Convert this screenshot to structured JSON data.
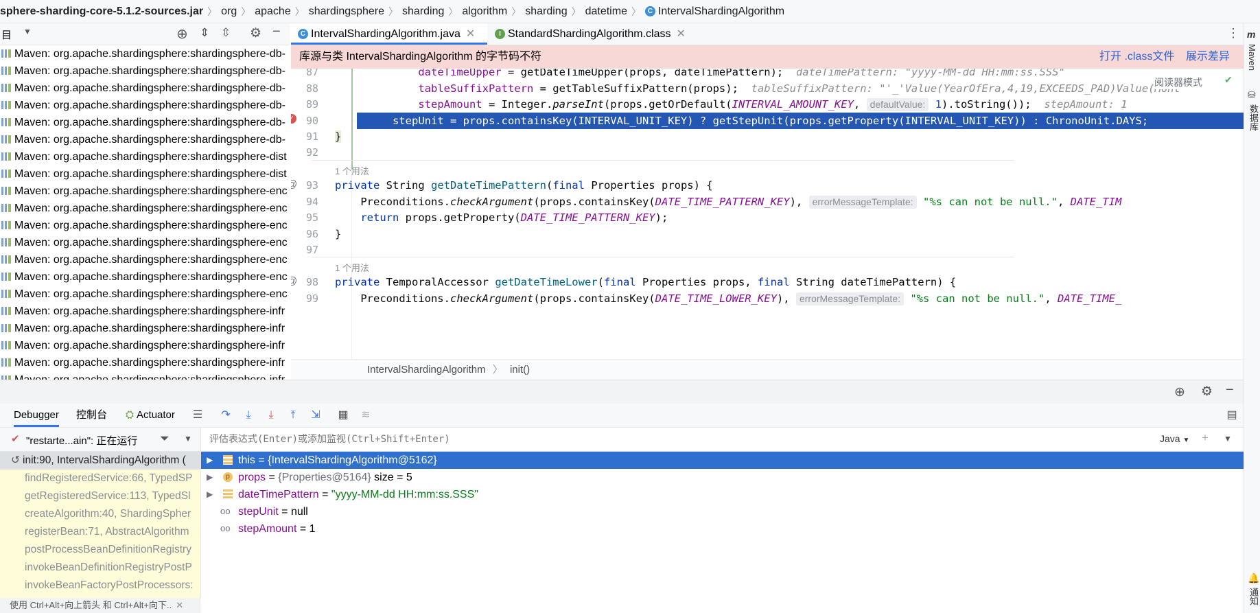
{
  "breadcrumb": [
    "sphere-sharding-core-5.1.2-sources.jar",
    "org",
    "apache",
    "shardingsphere",
    "sharding",
    "algorithm",
    "sharding",
    "datetime",
    "IntervalShardingAlgorithm"
  ],
  "project_panel": {
    "title": "目",
    "items": [
      "Maven: org.apache.shardingsphere:shardingsphere-db-",
      "Maven: org.apache.shardingsphere:shardingsphere-db-",
      "Maven: org.apache.shardingsphere:shardingsphere-db-",
      "Maven: org.apache.shardingsphere:shardingsphere-db-",
      "Maven: org.apache.shardingsphere:shardingsphere-db-",
      "Maven: org.apache.shardingsphere:shardingsphere-db-",
      "Maven: org.apache.shardingsphere:shardingsphere-dist",
      "Maven: org.apache.shardingsphere:shardingsphere-dist",
      "Maven: org.apache.shardingsphere:shardingsphere-enc",
      "Maven: org.apache.shardingsphere:shardingsphere-enc",
      "Maven: org.apache.shardingsphere:shardingsphere-enc",
      "Maven: org.apache.shardingsphere:shardingsphere-enc",
      "Maven: org.apache.shardingsphere:shardingsphere-enc",
      "Maven: org.apache.shardingsphere:shardingsphere-enc",
      "Maven: org.apache.shardingsphere:shardingsphere-enc",
      "Maven: org.apache.shardingsphere:shardingsphere-infr",
      "Maven: org.apache.shardingsphere:shardingsphere-infr",
      "Maven: org.apache.shardingsphere:shardingsphere-infr",
      "Maven: org.apache.shardingsphere:shardingsphere-infr",
      "Maven: org.apache.shardingsphere:shardingsphere-infr"
    ]
  },
  "tabs": [
    {
      "label": "IntervalShardingAlgorithm.java",
      "icon": "C"
    },
    {
      "label": "StandardShardingAlgorithm.class",
      "icon": "I"
    }
  ],
  "banner": {
    "message": "库源与类 IntervalShardingAlgorithm 的字节码不符",
    "open_class": "打开 .class文件",
    "show_diff": "展示差异"
  },
  "reader_mode": "阅读器模式",
  "code": {
    "l87": {
      "num": "87",
      "var": "dateTimeUpper",
      "rest": " = getDateTimeUpper(props, dateTimePattern);",
      "hint": "dateTimePattern: \"yyyy-MM-dd HH:mm:ss.SSS\""
    },
    "l88": {
      "num": "88",
      "var": "tableSuffixPattern",
      "rest": " = getTableSuffixPattern(props);",
      "hint": "tableSuffixPattern: \"'_'Value(YearOfEra,4,19,EXCEEDS_PAD)Value(Mont"
    },
    "l89": {
      "num": "89",
      "var": "stepAmount",
      "a": " = Integer.",
      "method": "parseInt",
      "b": "(props.getOrDefault(",
      "const": "INTERVAL_AMOUNT_KEY",
      "c": ", ",
      "param": "defaultValue:",
      "val": "1",
      "d": ").toString());",
      "hint": "stepAmount: 1"
    },
    "l90": {
      "num": "90",
      "text": "stepUnit = props.containsKey(INTERVAL_UNIT_KEY) ? getStepUnit(props.getProperty(INTERVAL_UNIT_KEY)) : ChronoUnit.DAYS;"
    },
    "l91": {
      "num": "91",
      "text": "}"
    },
    "l92": {
      "num": "92"
    },
    "usages1": "1 个用法",
    "l93": {
      "num": "93",
      "kw1": "private",
      "type": " String ",
      "method": "getDateTimePattern",
      "a": "(",
      "kw2": "final",
      "b": " Properties props) {"
    },
    "l94": {
      "num": "94",
      "a": "Preconditions.",
      "method": "checkArgument",
      "b": "(props.containsKey(",
      "const": "DATE_TIME_PATTERN_KEY",
      "c": "), ",
      "param": "errorMessageTemplate:",
      "str": " \"%s can not be null.\"",
      "d": ", ",
      "const2": "DATE_TIM"
    },
    "l95": {
      "num": "95",
      "kw": "return",
      "a": " props.getProperty(",
      "const": "DATE_TIME_PATTERN_KEY",
      "b": ");"
    },
    "l96": {
      "num": "96",
      "text": "}"
    },
    "l97": {
      "num": "97"
    },
    "usages2": "1 个用法",
    "l98": {
      "num": "98",
      "kw1": "private",
      "type": " TemporalAccessor ",
      "method": "getDateTimeLower",
      "a": "(",
      "kw2": "final",
      "b": " Properties props, ",
      "kw3": "final",
      "c": " String dateTimePattern) {"
    },
    "l99": {
      "num": "99",
      "a": "Preconditions.",
      "method": "checkArgument",
      "b": "(props.containsKey(",
      "const": "DATE_TIME_LOWER_KEY",
      "c": "), ",
      "param": "errorMessageTemplate:",
      "str": " \"%s can not be null.\"",
      "d": ", ",
      "const2": "DATE_TIME_"
    }
  },
  "editor_breadcrumb": {
    "class": "IntervalShardingAlgorithm",
    "method": "init()"
  },
  "debug": {
    "tabs": [
      "Debugger",
      "控制台",
      "Actuator"
    ],
    "thread": "\"restarte...ain\": 正在运行",
    "frames": [
      "init:90, IntervalShardingAlgorithm (",
      "findRegisteredService:66, TypedSP",
      "getRegisteredService:113, TypedSl",
      "createAlgorithm:40, ShardingSpher",
      "registerBean:71, AbstractAlgorithm",
      "postProcessBeanDefinitionRegistry",
      "invokeBeanDefinitionRegistryPostP",
      "invokeBeanFactoryPostProcessors:"
    ],
    "frames_hint": "使用 Ctrl+Alt+向上箭头 和 Ctrl+Alt+向下..",
    "eval_placeholder": "评估表达式(Enter)或添加监视(Ctrl+Shift+Enter)",
    "lang": "Java",
    "variables": [
      {
        "name": "this",
        "eq": " = ",
        "value": "{IntervalShardingAlgorithm@5162}",
        "extra": ""
      },
      {
        "name": "props",
        "eq": " = ",
        "value": "{Properties@5164}",
        "extra": "  size = 5"
      },
      {
        "name": "dateTimePattern",
        "eq": " = ",
        "value": "\"yyyy-MM-dd HH:mm:ss.SSS\"",
        "extra": ""
      },
      {
        "name": "stepUnit",
        "eq": " = ",
        "value": "null",
        "extra": ""
      },
      {
        "name": "stepAmount",
        "eq": " = ",
        "value": "1",
        "extra": ""
      }
    ]
  },
  "right_strip": {
    "maven": "Maven",
    "database": "数据库",
    "notifications": "通知"
  },
  "colors": {
    "accent": "#3574f0",
    "selection": "#2457b3",
    "banner": "#f8d7d7"
  }
}
